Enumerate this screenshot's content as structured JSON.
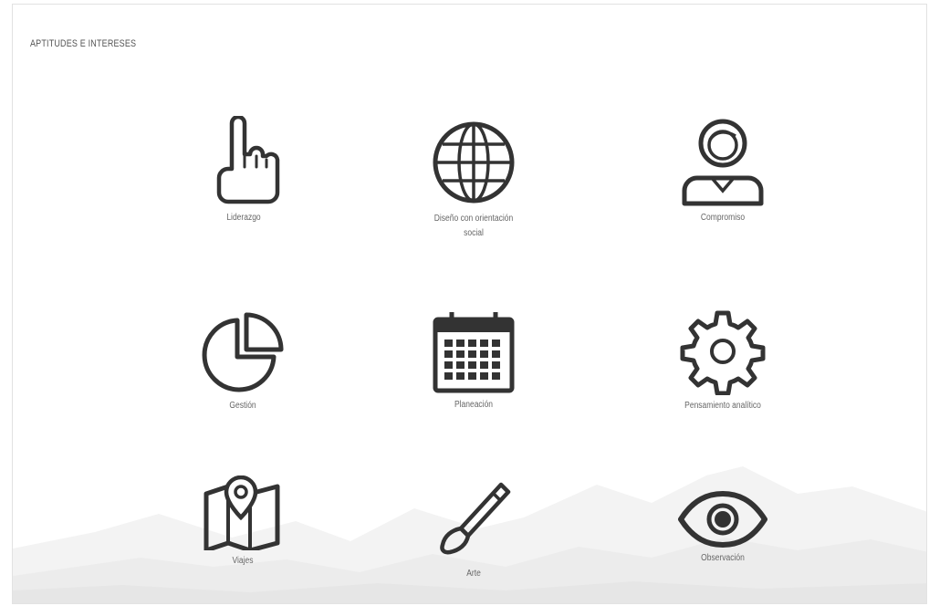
{
  "section": {
    "title": "APTITUDES E INTERESES"
  },
  "items": [
    {
      "label": "Liderazgo",
      "icon": "pointing-hand-icon"
    },
    {
      "label": "Diseño con orientación social",
      "icon": "globe-icon"
    },
    {
      "label": "Compromiso",
      "icon": "person-icon"
    },
    {
      "label": "Gestión",
      "icon": "pie-chart-icon"
    },
    {
      "label": "Planeación",
      "icon": "calendar-icon"
    },
    {
      "label": "Pensamiento analítico",
      "icon": "gear-icon"
    },
    {
      "label": "Viajes",
      "icon": "map-pin-icon"
    },
    {
      "label": "Arte",
      "icon": "paintbrush-icon"
    },
    {
      "label": "Observación",
      "icon": "eye-icon"
    }
  ],
  "colors": {
    "icon": "#333333",
    "text": "#666666",
    "mountain": "#ededed"
  }
}
